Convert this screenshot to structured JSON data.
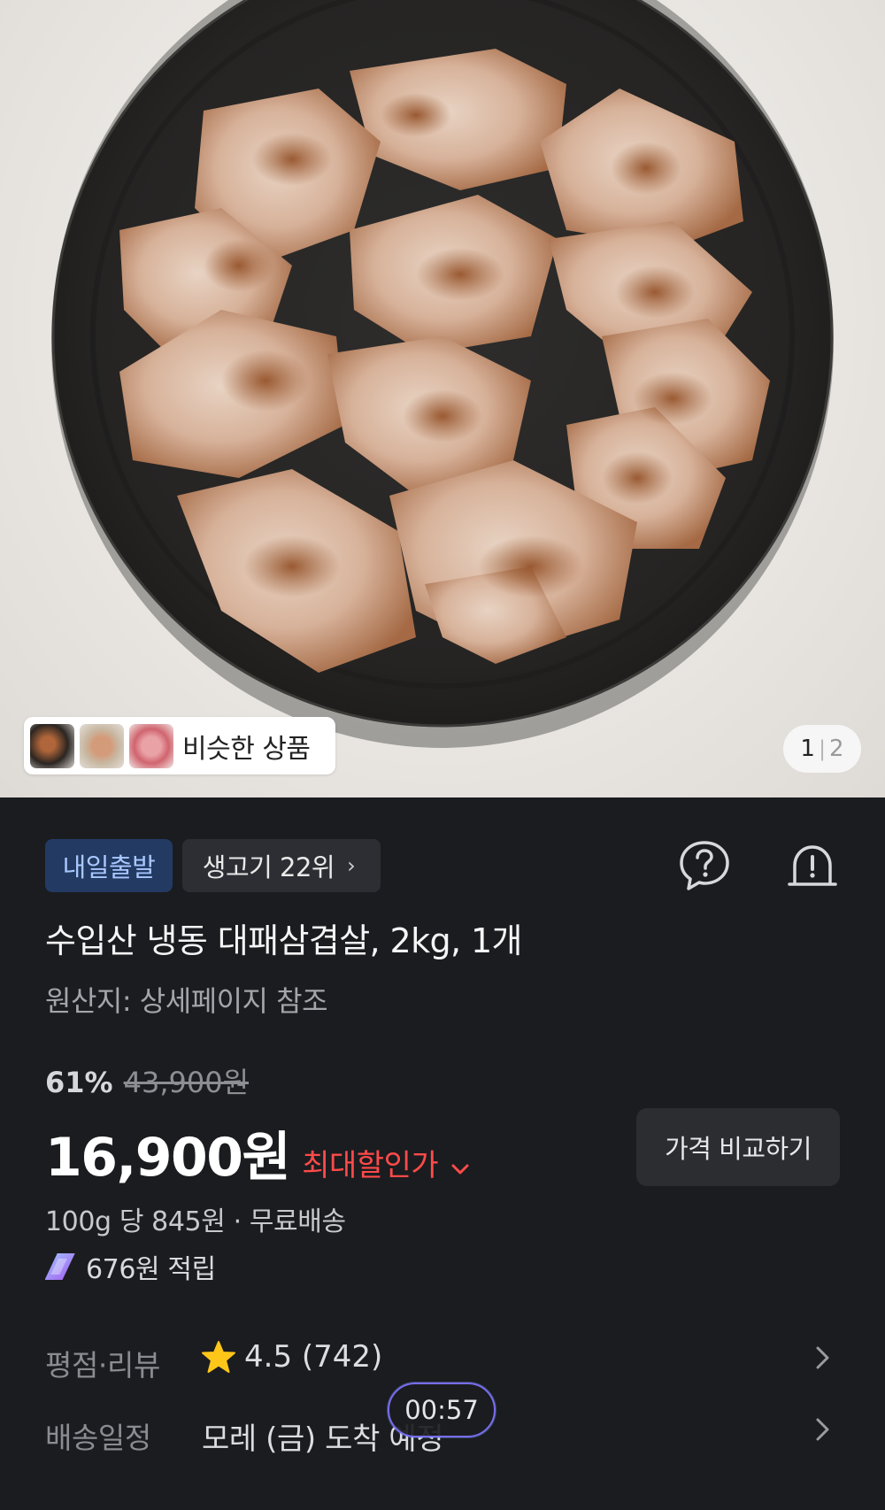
{
  "gallery": {
    "similar_label": "비슷한 상품",
    "pager_current": "1",
    "pager_separator": "|",
    "pager_total": "2"
  },
  "badges": {
    "shipping": "내일출발",
    "rank": "생고기 22위",
    "rank_chevron": "›"
  },
  "product": {
    "title": "수입산 냉동 대패삼겹살, 2kg, 1개",
    "origin": "원산지: 상세페이지 참조"
  },
  "pricing": {
    "discount_percent": "61%",
    "original_price": "43,900원",
    "price": "16,900원",
    "best_discount_label": "최대할인가",
    "compare_button": "가격 비교하기",
    "unit_price_line": "100g 당 845원 · 무료배송",
    "reward_line": "676원 적립"
  },
  "rating": {
    "label": "평점·리뷰",
    "value": "4.5 (742)"
  },
  "delivery": {
    "label": "배송일정",
    "value": "모레 (금) 도착 예정"
  },
  "timer": {
    "value": "00:57"
  },
  "colors": {
    "panel_bg": "#1b1c1f",
    "shipping_badge_bg": "#233a63",
    "shipping_badge_text": "#a9c8ff",
    "best_discount": "#ff4a4a",
    "star": "#ffc61a"
  },
  "icons": {
    "help": "question-circle-icon",
    "alarm": "alarm-bell-icon",
    "star": "star-icon",
    "reward": "coin-icon",
    "chevron": "chevron-right-icon"
  }
}
